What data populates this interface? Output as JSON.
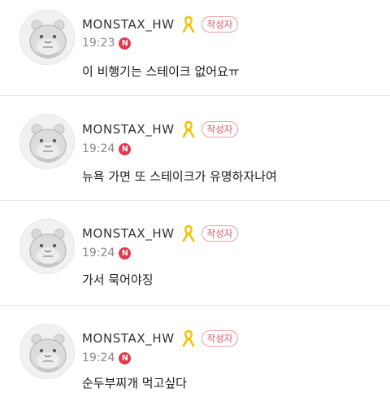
{
  "comments": [
    {
      "username": "MONSTAX_HW",
      "badge": "작성자",
      "time": "19:23",
      "new_label": "N",
      "text": "이 비행기는 스테이크 없어요ㅠ"
    },
    {
      "username": "MONSTAX_HW",
      "badge": "작성자",
      "time": "19:24",
      "new_label": "N",
      "text": "뉴욕 가면 또 스테이크가 유명하자나여"
    },
    {
      "username": "MONSTAX_HW",
      "badge": "작성자",
      "time": "19:24",
      "new_label": "N",
      "text": "가서 묵어야징"
    },
    {
      "username": "MONSTAX_HW",
      "badge": "작성자",
      "time": "19:24",
      "new_label": "N",
      "text": "순두부찌개 먹고싶다"
    }
  ],
  "icons": {
    "avatar": "hamster-avatar-icon",
    "ribbon": "yellow-ribbon-icon"
  },
  "colors": {
    "badge_border": "#e6a0a6",
    "badge_text": "#d9545f",
    "new_badge": "#e5384c",
    "ribbon": "#f2c200",
    "divider": "#ececec"
  }
}
